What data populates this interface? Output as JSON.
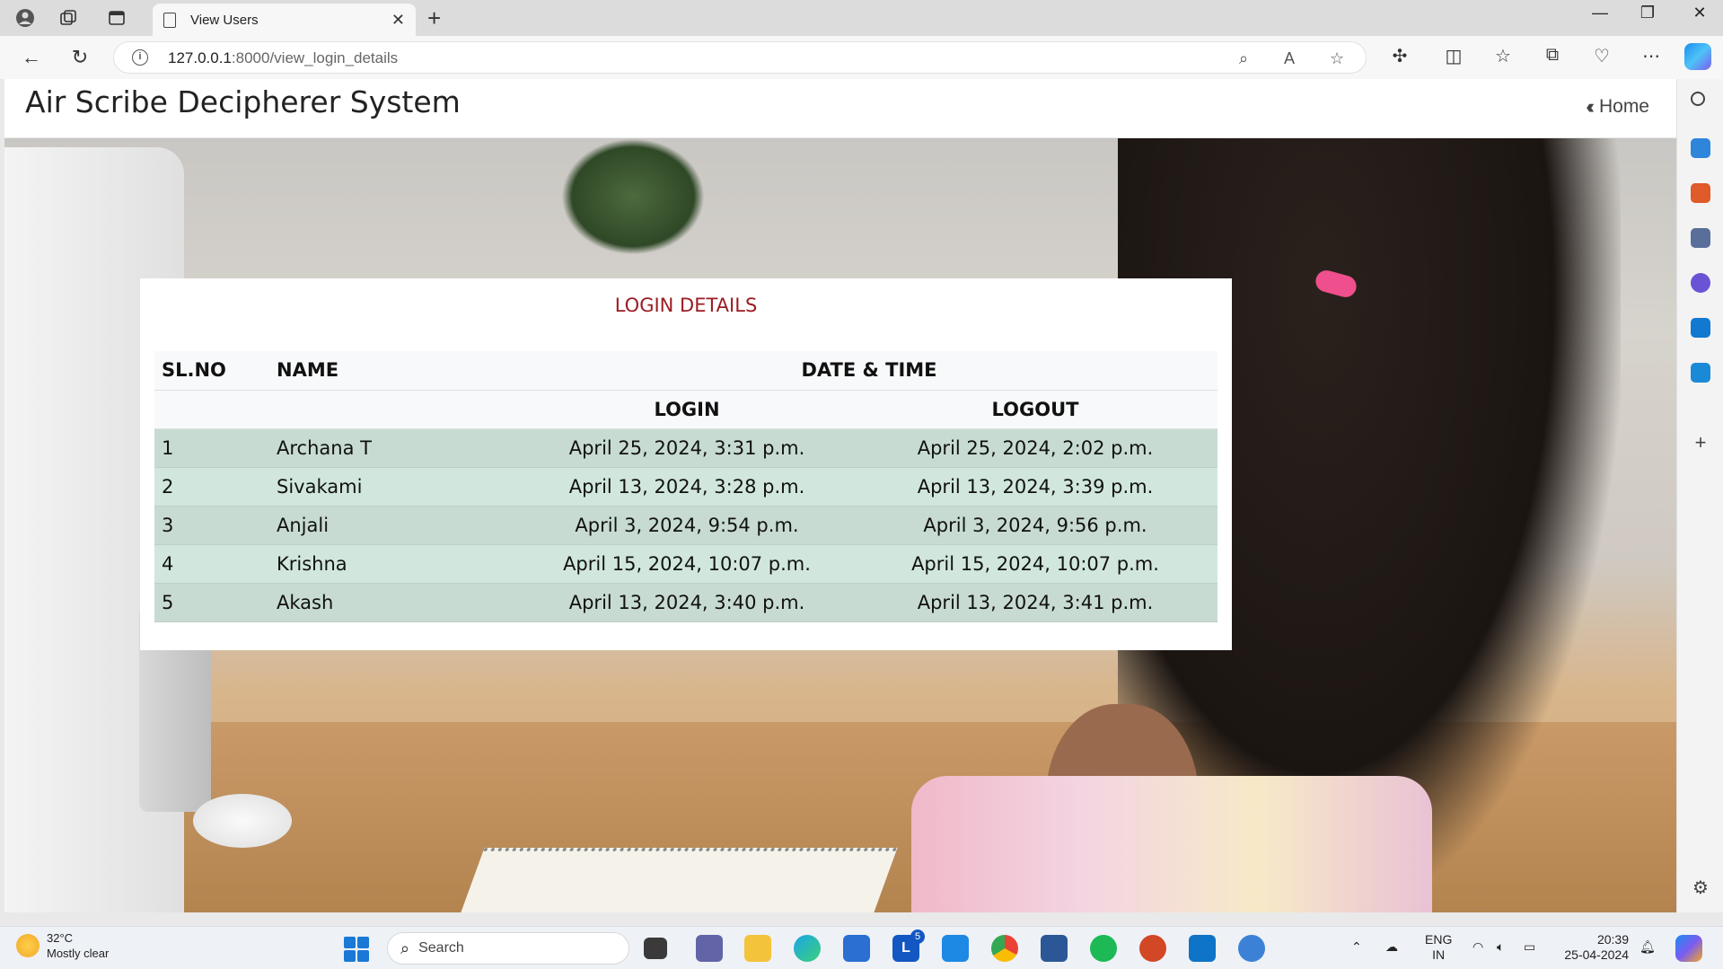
{
  "browser": {
    "tab_title": "View Users",
    "url_host": "127.0.0.1",
    "url_rest": ":8000/view_login_details"
  },
  "site": {
    "title": "Air Scribe Decipherer System",
    "home_label": "Home"
  },
  "card": {
    "title": "LOGIN DETAILS"
  },
  "table": {
    "headers": {
      "sl_no": "SL.NO",
      "name": "NAME",
      "date_time": "DATE & TIME",
      "login": "LOGIN",
      "logout": "LOGOUT"
    },
    "rows": [
      {
        "sl": "1",
        "name": "Archana T",
        "login": "April 25, 2024, 3:31 p.m.",
        "logout": "April 25, 2024, 2:02 p.m."
      },
      {
        "sl": "2",
        "name": "Sivakami",
        "login": "April 13, 2024, 3:28 p.m.",
        "logout": "April 13, 2024, 3:39 p.m."
      },
      {
        "sl": "3",
        "name": "Anjali",
        "login": "April 3, 2024, 9:54 p.m.",
        "logout": "April 3, 2024, 9:56 p.m."
      },
      {
        "sl": "4",
        "name": "Krishna",
        "login": "April 15, 2024, 10:07 p.m.",
        "logout": "April 15, 2024, 10:07 p.m."
      },
      {
        "sl": "5",
        "name": "Akash",
        "login": "April 13, 2024, 3:40 p.m.",
        "logout": "April 13, 2024, 3:41 p.m."
      }
    ]
  },
  "taskbar": {
    "temperature": "32°C",
    "weather": "Mostly clear",
    "search_label": "Search",
    "lang_1": "ENG",
    "lang_2": "IN",
    "time": "20:39",
    "date": "25-04-2024",
    "badge_count": "5"
  },
  "colors": {
    "title_red": "#9b1c22",
    "row_odd": "#c7dbd2",
    "row_even": "#d1e7dd"
  }
}
